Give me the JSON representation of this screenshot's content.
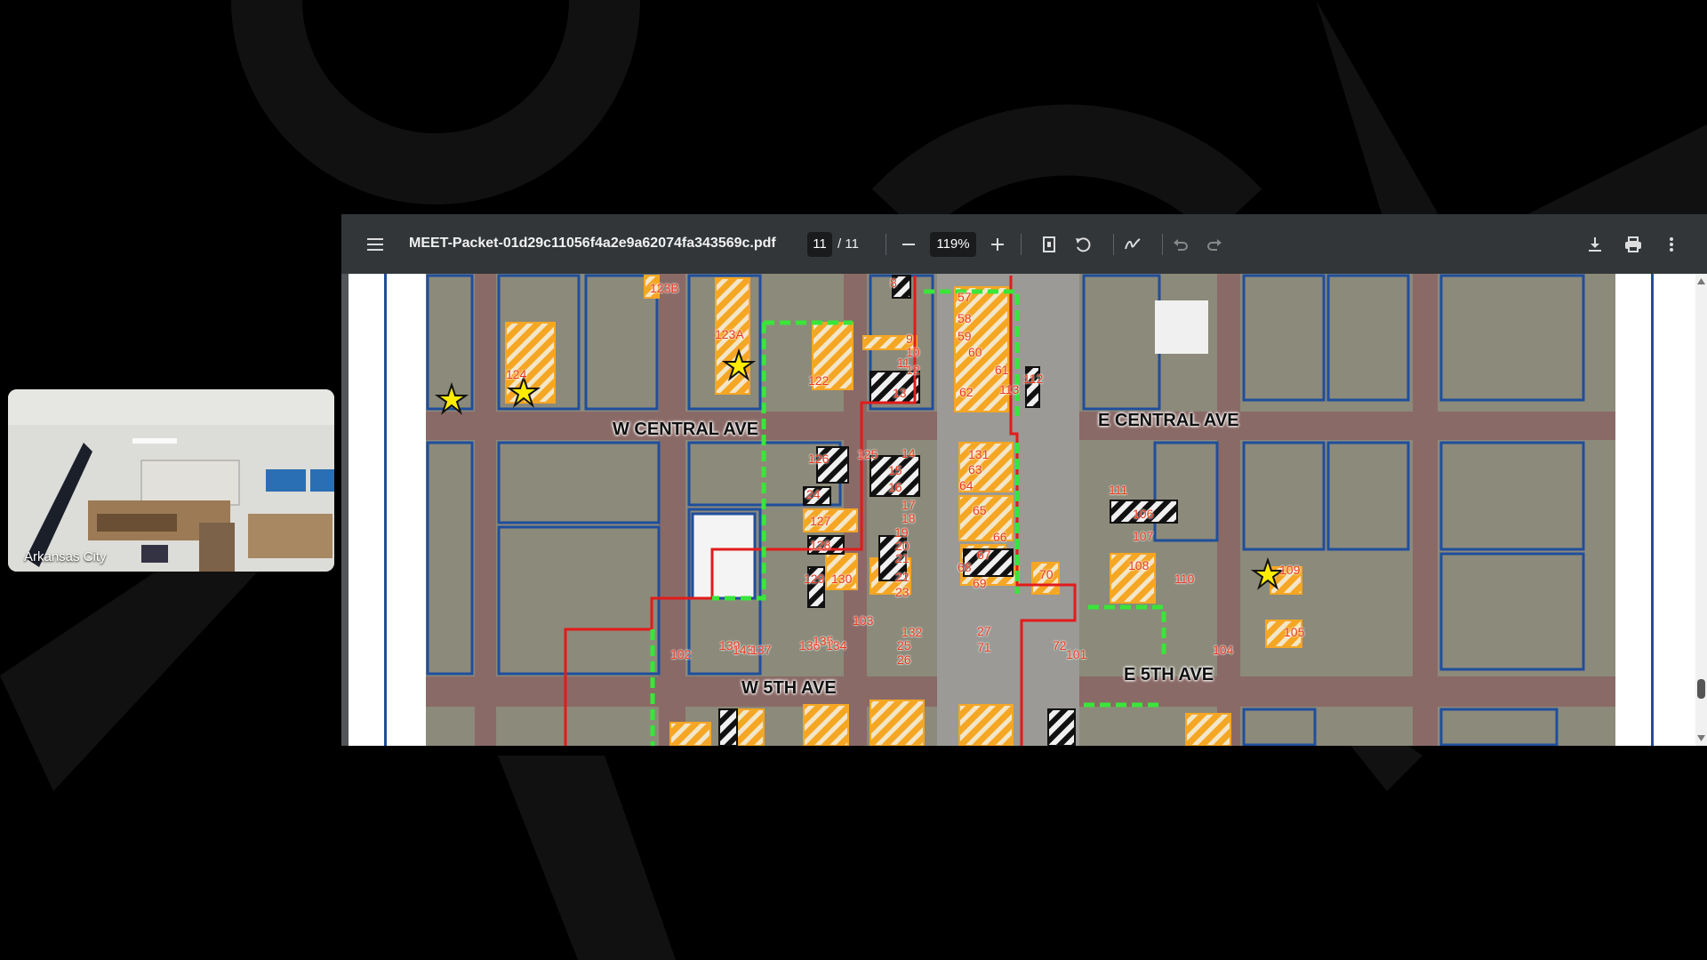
{
  "video": {
    "participant_name": "Arkansas City"
  },
  "pdf": {
    "filename": "MEET-Packet-01d29c11056f4a2e9a62074fa343569c.pdf",
    "page_current": "11",
    "page_total": "/ 11",
    "zoom": "119%"
  },
  "map": {
    "streets": [
      "W CENTRAL AVE",
      "E CENTRAL AVE",
      "W 5TH AVE",
      "E 5TH AVE"
    ],
    "parcels": [
      "123B",
      "123A",
      "124",
      "122",
      "8",
      "9",
      "10",
      "11",
      "12",
      "13",
      "57",
      "58",
      "59",
      "60",
      "61",
      "62",
      "113",
      "112",
      "126",
      "125",
      "14",
      "15",
      "16",
      "17",
      "18",
      "19",
      "20",
      "21",
      "22",
      "23",
      "24",
      "127",
      "128",
      "129",
      "130",
      "131",
      "63",
      "64",
      "65",
      "66",
      "67",
      "68",
      "69",
      "70",
      "111",
      "106",
      "107",
      "108",
      "110",
      "109",
      "105",
      "104",
      "103",
      "132",
      "25",
      "26",
      "27",
      "71",
      "72",
      "101",
      "102",
      "139",
      "143",
      "137",
      "136",
      "135",
      "134",
      "133"
    ]
  },
  "colors": {
    "toolbar": "#323639",
    "parcel_yellow": "#f5a623",
    "boundary_blue": "#1f4e9c",
    "district_red": "#e21b1b",
    "district_green": "#39e639"
  }
}
